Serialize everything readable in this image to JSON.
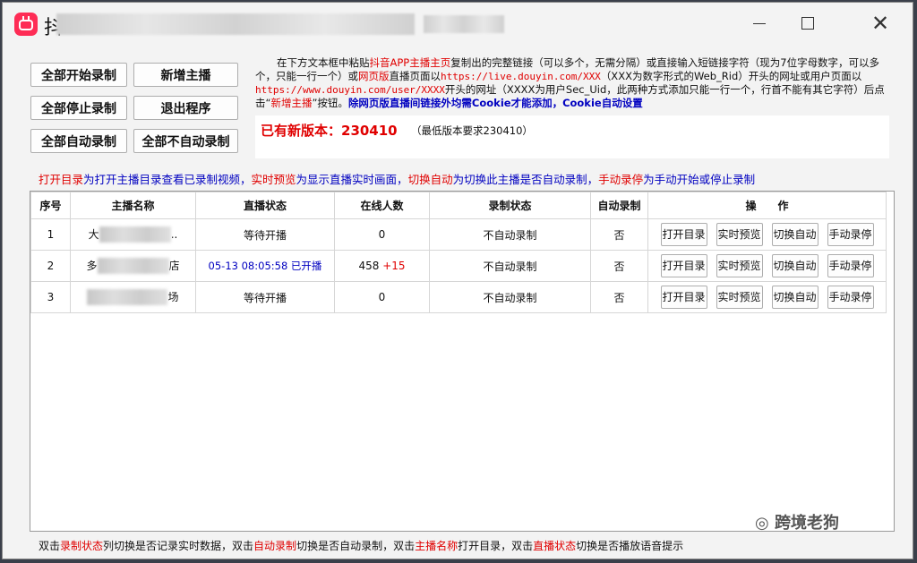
{
  "titlebar": {
    "title_prefix": "抖",
    "window_buttons": {
      "minimize": "minimize-icon",
      "maximize": "maximize-icon",
      "close": "close-icon"
    },
    "close_glyph": "✕"
  },
  "buttons": {
    "start_all": "全部开始录制",
    "add_streamer": "新增主播",
    "stop_all": "全部停止录制",
    "exit": "退出程序",
    "auto_all": "全部自动录制",
    "no_auto_all": "全部不自动录制"
  },
  "instructions": {
    "p1": "在下方文本框中粘贴",
    "p2": "抖音APP主播主页",
    "p3": "复制出的完整链接（可以多个，无需分隔）或直接输入短链接字符（现为7位字母数字，可以多个，只能一行一个）或",
    "p4": "网页版",
    "p5": "直播页面以",
    "p6": "https://live.douyin.com/XXX",
    "p7": "（XXX为数字形式的Web_Rid）开头的网址或用户页面以",
    "p8": "https://www.douyin.com/user/XXXX",
    "p9": "开头的网址（XXXX为用户Sec_Uid，此两种方式添加只能一行一个，行首不能有其它字符）后点击“",
    "p10": "新增主播",
    "p11": "”按钮。",
    "p12": "除网页版直播间链接外均需Cookie才能添加，Cookie自动设置"
  },
  "version": {
    "new_label": "已有新版本：230410",
    "min_label": "（最低版本要求230410）"
  },
  "hint": {
    "a1": "打开目录",
    "a2": "为打开主播目录查看已录制视频，",
    "b1": "实时预览",
    "b2": "为显示直播实时画面，",
    "c1": "切换自动",
    "c2": "为切换此主播是否自动录制，",
    "d1": "手动录停",
    "d2": "为手动开始或停止录制"
  },
  "table": {
    "headers": [
      "序号",
      "主播名称",
      "直播状态",
      "在线人数",
      "录制状态",
      "自动录制",
      "操　　作"
    ],
    "action_labels": [
      "打开目录",
      "实时预览",
      "切换自动",
      "手动录停"
    ],
    "rows": [
      {
        "index": "1",
        "name_start": "大",
        "name_end": "..",
        "live_status": "等待开播",
        "online": "0",
        "delta": "",
        "record_status": "不自动录制",
        "auto": "否"
      },
      {
        "index": "2",
        "name_start": "多",
        "name_end": "店",
        "live_status": "05-13 08:05:58 已开播",
        "online": "458",
        "delta": "+15",
        "record_status": "不自动录制",
        "auto": "否"
      },
      {
        "index": "3",
        "name_start": "",
        "name_end": "场",
        "live_status": "等待开播",
        "online": "0",
        "record_status": "不自动录制",
        "auto": "否",
        "delta": ""
      }
    ]
  },
  "watermark": {
    "icon": "wechat-icon",
    "text": "跨境老狗"
  },
  "footer": {
    "f1": "双击",
    "f2": "录制状态",
    "f3": "列切换是否记录实时数据，双击",
    "f4": "自动录制",
    "f5": "切换是否自动录制，双击",
    "f6": "主播名称",
    "f7": "打开目录，双击",
    "f8": "直播状态",
    "f9": "切换是否播放语音提示"
  }
}
